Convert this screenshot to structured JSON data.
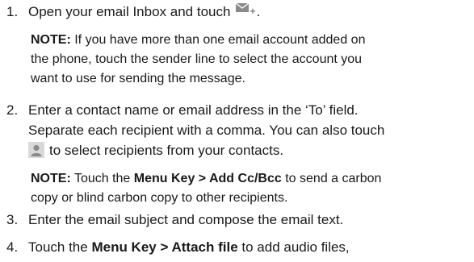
{
  "step1": {
    "number": "1.",
    "text": "Open your email Inbox and touch",
    "period": ".",
    "icon": "compose-email-icon"
  },
  "note1": {
    "label": "NOTE:",
    "line1": " If you have more than one email account added on",
    "line2": "the phone, touch the sender line to select the account you",
    "line3": "want to use for sending the message."
  },
  "step2": {
    "number": "2.",
    "line1": "Enter a contact name or email address in the ‘To’ field.",
    "line2": "Separate each recipient with a comma. You can also touch",
    "line3": "to select recipients from your contacts.",
    "icon": "contact-icon"
  },
  "note2": {
    "label": "NOTE:",
    "text_before": " Touch the ",
    "bold1": "Menu Key > Add Cc/Bcc",
    "text_after": " to send a carbon",
    "line2": "copy or blind carbon copy to other recipients."
  },
  "step3": {
    "number": "3.",
    "text": "Enter the email subject and compose the email text."
  },
  "step4": {
    "number": "4.",
    "text_before": "Touch the ",
    "bold1": "Menu Key > Attach file",
    "text_after": " to add audio files,"
  },
  "colors": {
    "text": "#1a1a1a",
    "icon_gray": "#8a8a8a",
    "icon_bg": "#d9d9d9"
  }
}
